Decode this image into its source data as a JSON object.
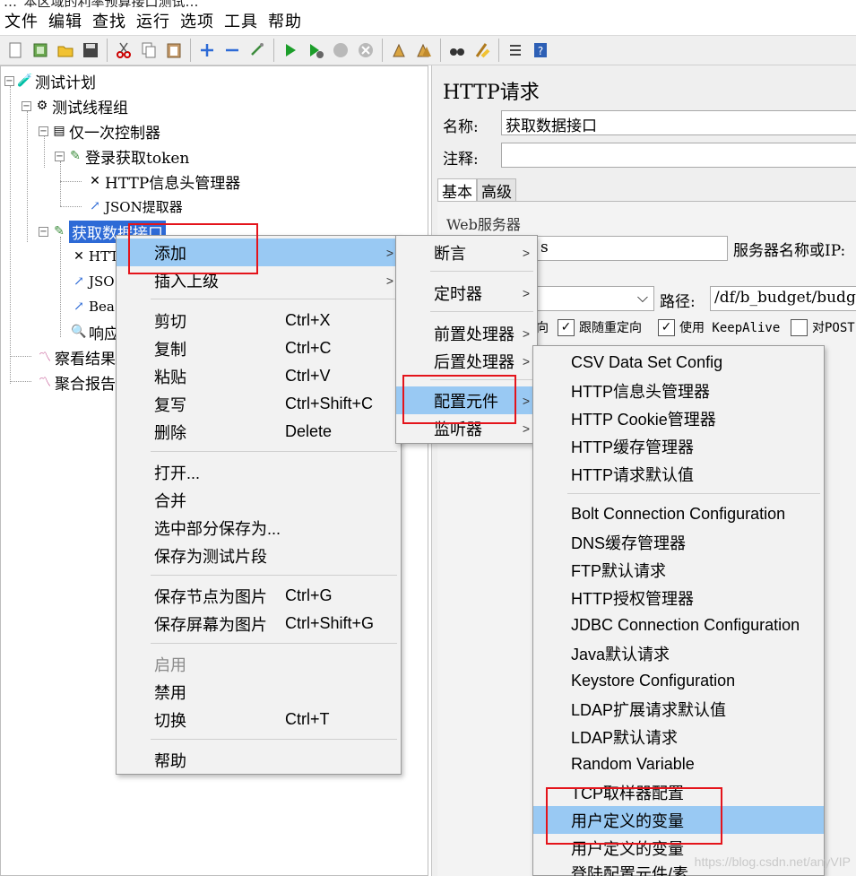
{
  "title_fragment": "…_本区域的利率预算接口测试…",
  "menubar": [
    "文件",
    "编辑",
    "查找",
    "运行",
    "选项",
    "工具",
    "帮助"
  ],
  "toolbar_icons": [
    "new-icon",
    "templates-icon",
    "open-icon",
    "save-icon",
    "cut-icon",
    "copy-icon",
    "paste-icon",
    "expand-icon",
    "collapse-icon",
    "toggle-icon",
    "start-icon",
    "start-no-pause-icon",
    "stop-icon",
    "shutdown-icon",
    "clear-icon",
    "clear-all-icon",
    "search-icon",
    "reset-search-icon",
    "function-helper-icon",
    "help-icon"
  ],
  "tree": {
    "plan": "测试计划",
    "thread_group": "测试线程组",
    "once_controller": "仅一次控制器",
    "login": "登录获取token",
    "header_manager": "HTTP信息头管理器",
    "json_extractor": "JSON提取器",
    "fetch": "获取数据接口",
    "child_http": "HTT",
    "child_json": "JSO",
    "child_bea": "Bea",
    "child_resp": "响应",
    "view_results": "察看结果",
    "aggregate": "聚合报告"
  },
  "right": {
    "title": "HTTP请求",
    "name_label": "名称:",
    "name_value": "获取数据接口",
    "comment_label": "注释:",
    "comment_value": "",
    "tab_basic": "基本",
    "tab_advanced": "高级",
    "web_server": "Web服务器",
    "server_partial": "s",
    "server_label": "服务器名称或IP:",
    "path_label": "路径:",
    "path_value": "/df/b_budget/budge",
    "opt_redirect_partial": "向",
    "opt_follow": "跟随重定向",
    "opt_keepalive": "使用 KeepAlive",
    "opt_post": "对POST"
  },
  "menu1": {
    "add": "添加",
    "insert_parent": "插入上级",
    "cut": "剪切",
    "cut_sc": "Ctrl+X",
    "copy": "复制",
    "copy_sc": "Ctrl+C",
    "paste": "粘贴",
    "paste_sc": "Ctrl+V",
    "duplicate": "复写",
    "duplicate_sc": "Ctrl+Shift+C",
    "delete": "删除",
    "delete_sc": "Delete",
    "open": "打开...",
    "merge": "合并",
    "save_selection": "选中部分保存为...",
    "save_fragment": "保存为测试片段",
    "save_node_img": "保存节点为图片",
    "save_node_img_sc": "Ctrl+G",
    "save_screen_img": "保存屏幕为图片",
    "save_screen_img_sc": "Ctrl+Shift+G",
    "enable": "启用",
    "disable": "禁用",
    "toggle": "切换",
    "toggle_sc": "Ctrl+T",
    "help": "帮助"
  },
  "menu2": {
    "assertion": "断言",
    "timer": "定时器",
    "pre_processor": "前置处理器",
    "post_processor": "后置处理器",
    "config_element": "配置元件",
    "listener": "监听器"
  },
  "menu3": [
    "CSV Data Set Config",
    "HTTP信息头管理器",
    "HTTP Cookie管理器",
    "HTTP缓存管理器",
    "HTTP请求默认值",
    "Bolt Connection Configuration",
    "DNS缓存管理器",
    "FTP默认请求",
    "HTTP授权管理器",
    "JDBC Connection Configuration",
    "Java默认请求",
    "Keystore Configuration",
    "LDAP扩展请求默认值",
    "LDAP默认请求",
    "Random Variable",
    "TCP取样器配置",
    "用户定义的变量",
    "用户定义的变量",
    "登陆配置元件/素"
  ],
  "watermark": "https://blog.csdn.net/anyVIP",
  "colors": {
    "highlight": "#99c9f3",
    "selection": "#2d6ad6",
    "annotation": "#e4141b"
  }
}
